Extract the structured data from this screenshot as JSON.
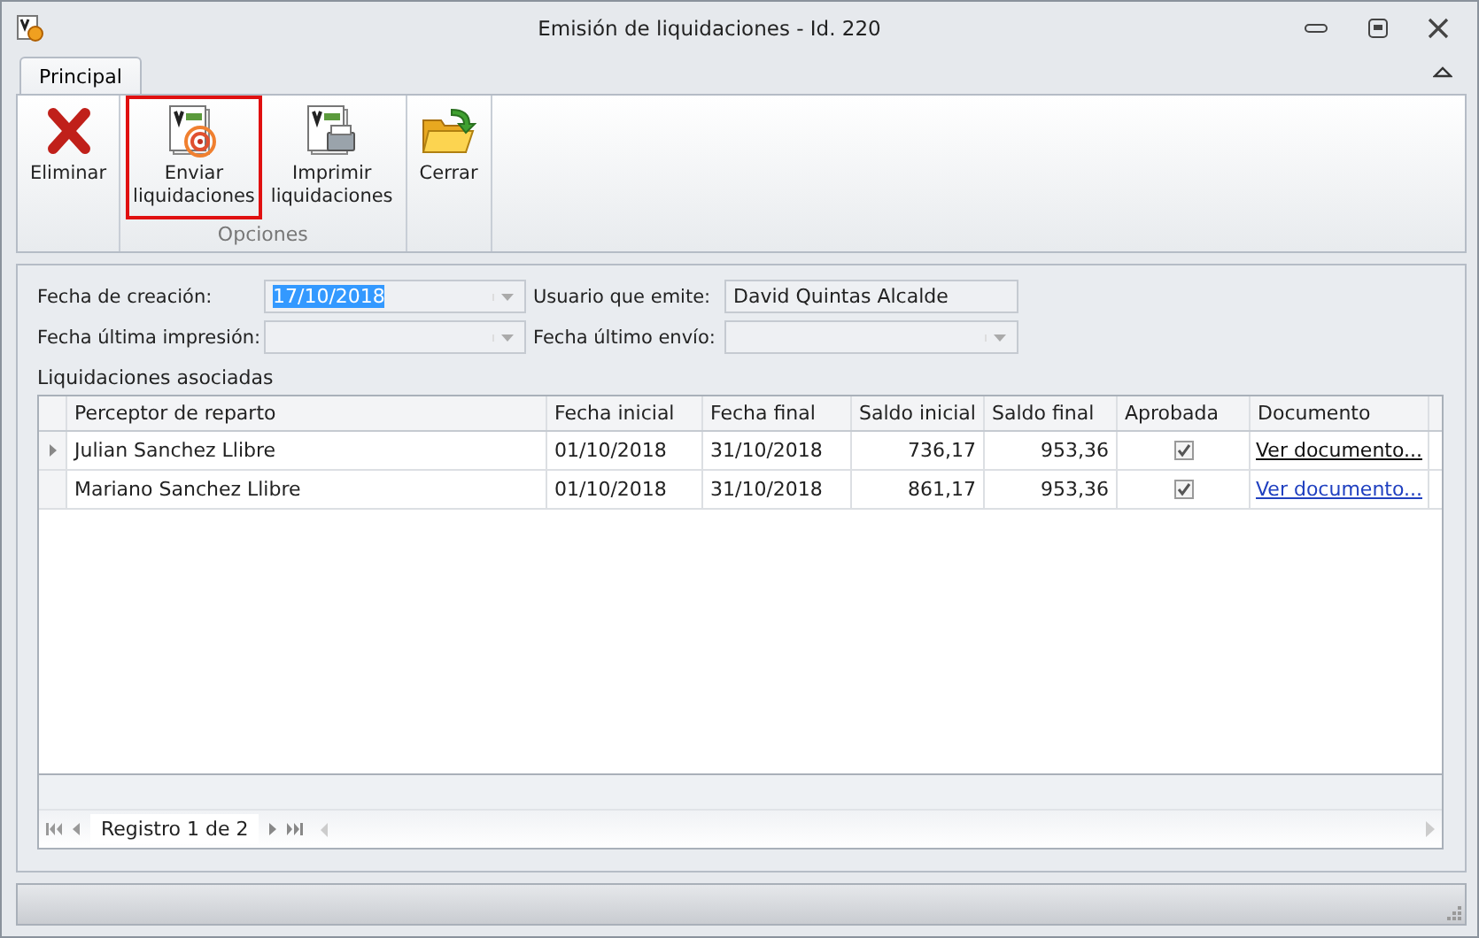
{
  "window": {
    "title": "Emisión de liquidaciones - Id. 220"
  },
  "tabs": [
    {
      "label": "Principal",
      "selected": true
    }
  ],
  "ribbon": {
    "groups": [
      {
        "buttons": [
          {
            "label": "Eliminar",
            "kind": "delete",
            "selected": false
          }
        ]
      },
      {
        "label": "Opciones",
        "buttons": [
          {
            "label": "Enviar liquidaciones",
            "kind": "send",
            "selected": true
          },
          {
            "label": "Imprimir liquidaciones",
            "kind": "print",
            "selected": false
          }
        ]
      },
      {
        "buttons": [
          {
            "label": "Cerrar",
            "kind": "close",
            "selected": false
          }
        ]
      }
    ]
  },
  "form": {
    "fields": [
      {
        "label": "Fecha de creación:",
        "value": "17/10/2018",
        "kind": "combo",
        "highlighted": true
      },
      {
        "label": "Usuario que emite:",
        "value": "David Quintas Alcalde",
        "kind": "text",
        "highlighted": false
      },
      {
        "label": "Fecha última impresión:",
        "kind": "combo"
      },
      {
        "label": "Fecha último envío:",
        "kind": "combo"
      }
    ]
  },
  "grid": {
    "title": "Liquidaciones asociadas",
    "columns": [
      "Perceptor de reparto",
      "Fecha inicial",
      "Fecha final",
      "Saldo inicial",
      "Saldo final",
      "Aprobada",
      "Documento"
    ],
    "rows": [
      {
        "perceptor": "Julian Sanchez Llibre",
        "fecha_inicial": "01/10/2018",
        "fecha_final": "31/10/2018",
        "saldo_inicial": "736,17",
        "saldo_final": "953,36",
        "aprobada": true,
        "documento": "Ver documento...",
        "selected": true
      },
      {
        "perceptor": "Mariano Sanchez Llibre",
        "fecha_inicial": "01/10/2018",
        "fecha_final": "31/10/2018",
        "saldo_inicial": "861,17",
        "saldo_final": "953,36",
        "aprobada": true,
        "documento": "Ver documento...",
        "selected": false
      }
    ],
    "navigator": "Registro 1 de 2"
  }
}
